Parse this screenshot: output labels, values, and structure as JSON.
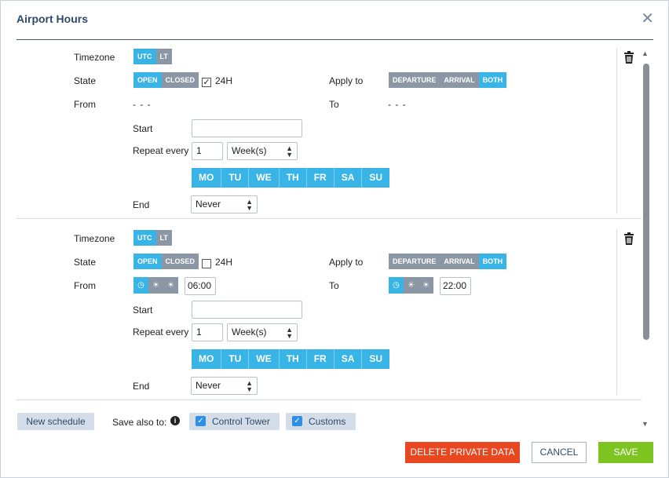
{
  "dialog": {
    "title": "Airport Hours",
    "close": "✕"
  },
  "labels": {
    "timezone": "Timezone",
    "state": "State",
    "apply_to": "Apply to",
    "from": "From",
    "to": "To",
    "start": "Start",
    "repeat_every": "Repeat every",
    "end": "End",
    "h24": "24H"
  },
  "options": {
    "timezone": [
      "UTC",
      "LT"
    ],
    "state": [
      "OPEN",
      "CLOSED"
    ],
    "apply_to": [
      "DEPARTURE",
      "ARRIVAL",
      "BOTH"
    ],
    "days": [
      "MO",
      "TU",
      "WE",
      "TH",
      "FR",
      "SA",
      "SU"
    ]
  },
  "schedules": [
    {
      "timezone": "UTC",
      "state": "OPEN",
      "h24": true,
      "apply_to": "BOTH",
      "from_text": "- - -",
      "to_text": "- - -",
      "start": "",
      "repeat_value": "1",
      "repeat_unit": "Week(s)",
      "end": "Never"
    },
    {
      "timezone": "UTC",
      "state": "OPEN",
      "h24": false,
      "apply_to": "BOTH",
      "from_time": "06:00",
      "to_time": "22:00",
      "start": "",
      "repeat_value": "1",
      "repeat_unit": "Week(s)",
      "end": "Never"
    }
  ],
  "footer": {
    "new_schedule": "New schedule",
    "save_also": "Save also to:",
    "info": "i",
    "control_tower": "Control Tower",
    "customs": "Customs",
    "delete": "DELETE PRIVATE DATA",
    "cancel": "CANCEL",
    "save": "SAVE"
  },
  "colors": {
    "accent": "#39b4e6",
    "inactive": "#8c97a5",
    "delete": "#e8471f",
    "save": "#7dc421",
    "title": "#2f4a68"
  }
}
